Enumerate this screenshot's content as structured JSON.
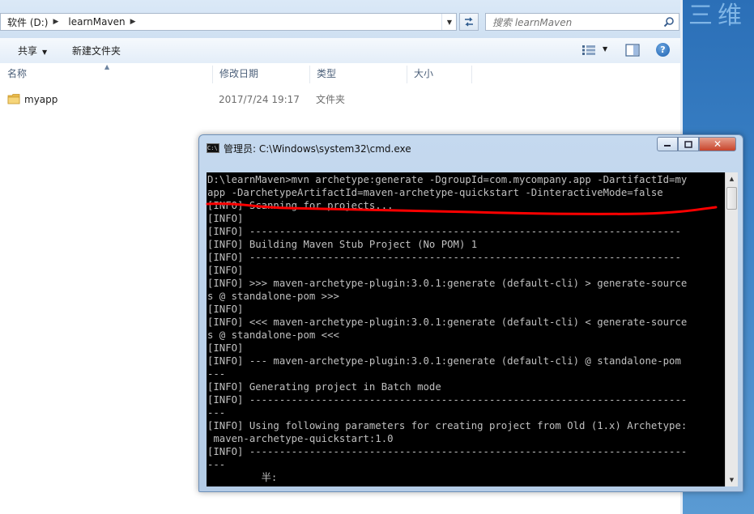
{
  "explorer": {
    "breadcrumb": {
      "drive": "软件 (D:)",
      "folder": "learnMaven"
    },
    "search": {
      "placeholder": "搜索 learnMaven"
    },
    "toolbar": {
      "share_label": "共享",
      "new_folder_label": "新建文件夹"
    },
    "columns": {
      "name": "名称",
      "modified": "修改日期",
      "type": "类型",
      "size": "大小"
    },
    "files": [
      {
        "name": "myapp",
        "modified": "2017/7/24 19:17",
        "type": "文件夹"
      }
    ]
  },
  "desktop": {
    "background_text": "三维"
  },
  "cmd": {
    "title": "管理员: C:\\Windows\\system32\\cmd.exe",
    "icon_label": "C:\\",
    "lines": [
      "D:\\learnMaven>mvn archetype:generate -DgroupId=com.mycompany.app -DartifactId=my",
      "app -DarchetypeArtifactId=maven-archetype-quickstart -DinteractiveMode=false",
      "[INFO] Scanning for projects...",
      "[INFO]",
      "[INFO] ------------------------------------------------------------------------",
      "[INFO] Building Maven Stub Project (No POM) 1",
      "[INFO] ------------------------------------------------------------------------",
      "[INFO]",
      "[INFO] >>> maven-archetype-plugin:3.0.1:generate (default-cli) > generate-source",
      "s @ standalone-pom >>>",
      "[INFO]",
      "[INFO] <<< maven-archetype-plugin:3.0.1:generate (default-cli) < generate-source",
      "s @ standalone-pom <<<",
      "[INFO]",
      "[INFO] --- maven-archetype-plugin:3.0.1:generate (default-cli) @ standalone-pom",
      "---",
      "[INFO] Generating project in Batch mode",
      "[INFO] -------------------------------------------------------------------------",
      "---",
      "[INFO] Using following parameters for creating project from Old (1.x) Archetype:",
      " maven-archetype-quickstart:1.0",
      "[INFO] -------------------------------------------------------------------------",
      "---",
      "         半:"
    ]
  },
  "colors": {
    "console_bg": "#000000",
    "console_text": "#c0c0c0",
    "annotation": "#ff0000",
    "close_button": "#c8442b"
  }
}
